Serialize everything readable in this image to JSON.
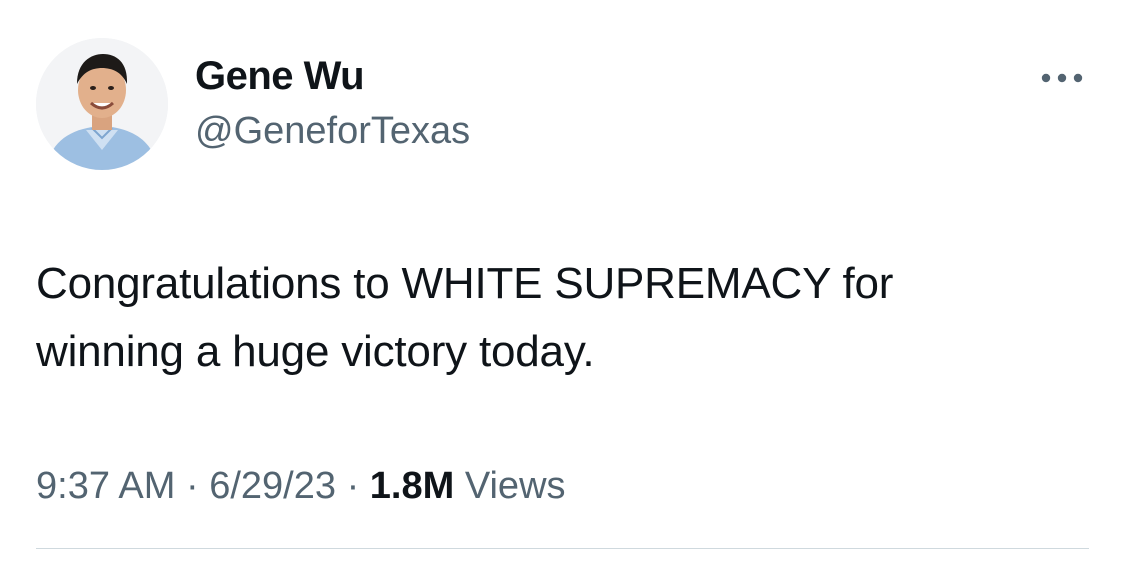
{
  "tweet": {
    "author": {
      "name": "Gene Wu",
      "handle": "@GeneforTexas",
      "avatar_icon": "profile-photo"
    },
    "text": "Congratulations to WHITE SUPREMACY for\nwinning a huge victory today.",
    "time": "9:37 AM",
    "date": "6/29/23",
    "separator": "·",
    "views_count": "1.8M",
    "views_label": "Views",
    "more_icon": "more-options-icon"
  },
  "colors": {
    "text_primary": "#0f1419",
    "text_secondary": "#536471",
    "divider": "#cfd9de"
  }
}
